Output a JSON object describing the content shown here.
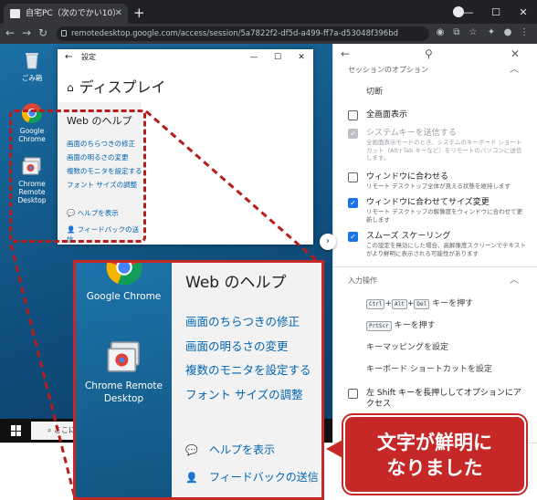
{
  "browser": {
    "tab_title": "自宅PC（次のでかい10）",
    "new_tab": "+",
    "url": "remotedesktop.google.com/access/session/5a7822f2-df5d-a499-ff7a-d53048f396bd",
    "window_controls": [
      "—",
      "☐",
      "✕"
    ]
  },
  "desktop": {
    "icons": [
      {
        "label": "ごみ箱"
      },
      {
        "label": "Google Chrome"
      },
      {
        "label": "Chrome Remote Desktop"
      }
    ],
    "settings_window": {
      "title": "設定",
      "heading": "ディスプレイ",
      "help_title": "Web のヘルプ",
      "links": [
        "画面のちらつきの修正",
        "画面の明るさの変更",
        "複数のモニタを設定する",
        "フォント サイズの調整"
      ],
      "help_link": "ヘルプを表示",
      "feedback_link": "フィードバックの送信"
    },
    "taskbar_search": "ここに入"
  },
  "panel": {
    "session_header": "セッションのオプション",
    "disconnect": "切断",
    "options": [
      {
        "title": "全画面表示",
        "desc": "",
        "checked": false,
        "disabled": false
      },
      {
        "title": "システムキーを送信する",
        "desc": "全画面表示モードのとき、システムのキーボード ショートカット（Alt+Tab キーなど）をリモートのパソコンに送信します。",
        "checked": true,
        "disabled": true
      },
      {
        "title": "ウィンドウに合わせる",
        "desc": "リモート デスクトップ全体が見える状態を維持します",
        "checked": false,
        "disabled": false
      },
      {
        "title": "ウィンドウに合わせてサイズ変更",
        "desc": "リモート デスクトップの解像度をウィンドウに合わせて更新します",
        "checked": true,
        "disabled": false
      },
      {
        "title": "スムーズ スケーリング",
        "desc": "この設定を無効にした場合、高解像度スクリーンでテキストがより鮮明に表示される可能性があります",
        "checked": true,
        "disabled": false
      }
    ],
    "input_header": "入力操作",
    "key_combo": [
      "Ctrl",
      "Alt",
      "Del"
    ],
    "key_combo_suffix": "キーを押す",
    "prtscr_key": "PrtScr",
    "prtscr_suffix": "キーを押す",
    "key_mapping": "キーマッピングを設定",
    "keyboard_shortcut": "キーボード ショートカットを設定",
    "shift_option": "左 Shift キーを長押ししてオプションにアクセス"
  },
  "zoom": {
    "icons": [
      "Google Chrome",
      "Chrome Remote Desktop"
    ],
    "help_title": "Web のヘルプ",
    "links": [
      "画面のちらつきの修正",
      "画面の明るさの変更",
      "複数のモニタを設定する",
      "フォント サイズの調整"
    ],
    "help_link": "ヘルプを表示",
    "feedback_link": "フィードバックの送信"
  },
  "callout": {
    "line1": "文字が鮮明に",
    "line2": "なりました"
  },
  "colors": {
    "accent_red": "#c62828",
    "link_blue": "#0063b1",
    "checkbox_blue": "#1a73e8"
  }
}
